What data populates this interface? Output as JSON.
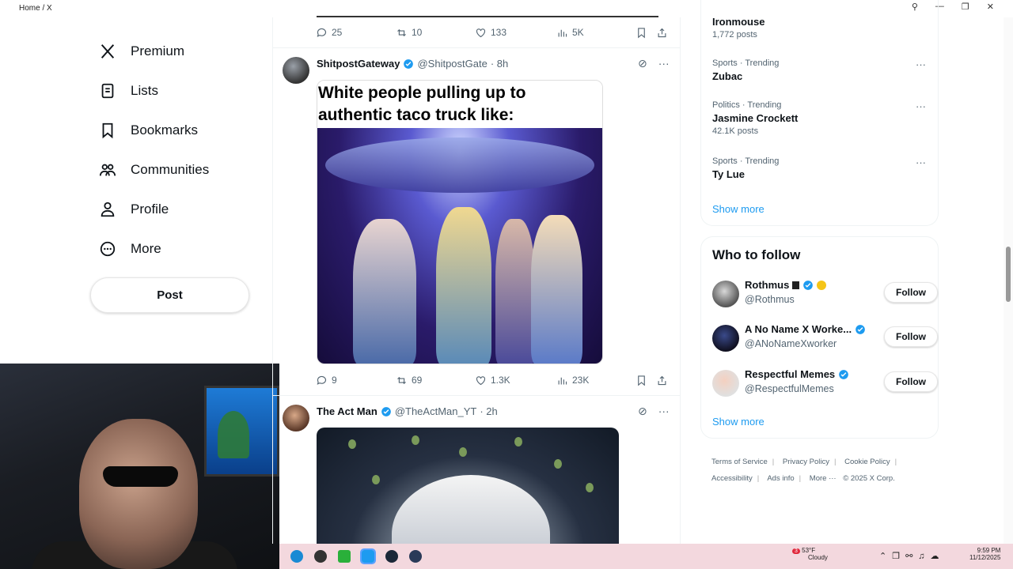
{
  "window": {
    "title": "Home / X"
  },
  "nav": {
    "items": [
      {
        "label": "Premium",
        "icon": "x-logo-icon"
      },
      {
        "label": "Lists",
        "icon": "list-icon"
      },
      {
        "label": "Bookmarks",
        "icon": "bookmark-icon"
      },
      {
        "label": "Communities",
        "icon": "communities-icon"
      },
      {
        "label": "Profile",
        "icon": "profile-icon"
      },
      {
        "label": "More",
        "icon": "more-circle-icon"
      }
    ],
    "post_label": "Post"
  },
  "feed": {
    "prev_actions": {
      "replies": "25",
      "reposts": "10",
      "likes": "133",
      "views": "5K"
    },
    "tweets": [
      {
        "name": "ShitpostGateway",
        "handle": "@ShitpostGate",
        "time": "· 8h",
        "image_caption": "White people pulling up to authentic taco truck like:",
        "actions": {
          "replies": "9",
          "reposts": "69",
          "likes": "1.3K",
          "views": "23K"
        }
      },
      {
        "name": "The Act Man",
        "handle": "@TheActMan_YT",
        "time": "· 2h"
      }
    ]
  },
  "trends": {
    "top_item": {
      "title": "Ironmouse",
      "posts": "1,772 posts"
    },
    "items": [
      {
        "category": "Sports · Trending",
        "title": "Zubac",
        "posts": ""
      },
      {
        "category": "Politics · Trending",
        "title": "Jasmine Crockett",
        "posts": "42.1K posts"
      },
      {
        "category": "Sports · Trending",
        "title": "Ty Lue",
        "posts": ""
      }
    ],
    "show_more": "Show more"
  },
  "who_to_follow": {
    "title": "Who to follow",
    "accounts": [
      {
        "name": "Rothmus",
        "handle": "@Rothmus",
        "button": "Follow"
      },
      {
        "name": "A No Name X Worke...",
        "handle": "@ANoNameXworker",
        "button": "Follow"
      },
      {
        "name": "Respectful Memes",
        "handle": "@RespectfulMemes",
        "button": "Follow"
      }
    ],
    "show_more": "Show more"
  },
  "footer": {
    "links": [
      "Terms of Service",
      "Privacy Policy",
      "Cookie Policy",
      "Accessibility",
      "Ads info",
      "More ···"
    ],
    "copyright": "© 2025 X Corp."
  },
  "taskbar": {
    "weather_temp": "53°F",
    "weather_desc": "Cloudy",
    "time": "9:59 PM",
    "date": "11/12/2025",
    "notification_count": "3"
  },
  "colors": {
    "accent": "#1d9bf0",
    "text_secondary": "#536471",
    "taskbar": "#f3d8de"
  }
}
